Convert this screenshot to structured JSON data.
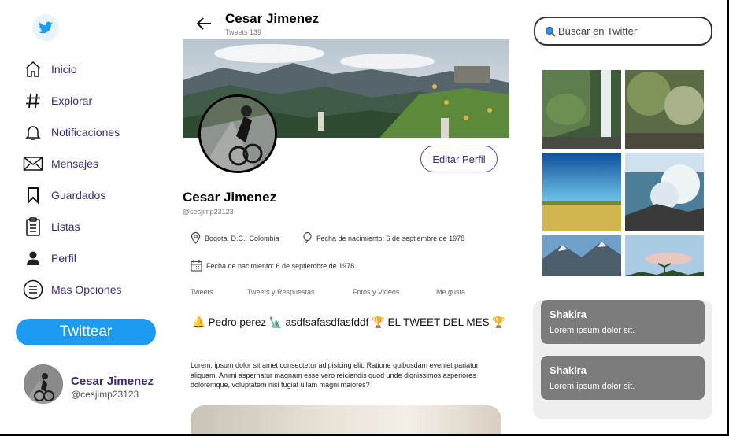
{
  "sidebar": {
    "logo": "twitter-bird-icon",
    "items": [
      {
        "label": "Inicio",
        "icon": "home-icon"
      },
      {
        "label": "Explorar",
        "icon": "hashtag-icon"
      },
      {
        "label": "Notificaciones",
        "icon": "bell-icon"
      },
      {
        "label": "Mensajes",
        "icon": "envelope-icon"
      },
      {
        "label": "Guardados",
        "icon": "bookmark-icon"
      },
      {
        "label": "Listas",
        "icon": "clipboard-icon"
      },
      {
        "label": "Perfil",
        "icon": "person-icon"
      },
      {
        "label": "Mas Opciones",
        "icon": "more-options-icon"
      }
    ],
    "tweet_button": "Twittear",
    "account": {
      "name": "Cesar Jimenez",
      "handle": "@cesjimp23123"
    }
  },
  "header": {
    "name": "Cesar Jimenez",
    "tweet_count": "Tweets 139"
  },
  "profile": {
    "edit_button": "Editar Perfil",
    "name": "Cesar Jimenez",
    "handle": "@cesjimp23123",
    "location": "Bogota, D.C., Colombia",
    "birth": "Fecha de nacimiento: 6 de septiembre de 1978",
    "joined": "Fecha de nacimiento: 6 de septiembre de 1978"
  },
  "tabs": [
    "Tweets",
    "Tweets y Respuestas",
    "Fotos y Videos",
    "Me gusta"
  ],
  "tweet": {
    "headline": "🔔 Pedro perez 🗽 asdfsafasdfasfddf 🏆 EL TWEET DEL MES 🏆",
    "body": "Lorem, ipsum dolor sit amet consectetur adipisicing elit. Ratione quibusdam eveniet pariatur aliquam. Animi aspernatur magnam esse vero reiciendis quod unde dignissimos asperiores doloremque, voluptatem nisi fugiat ullam magni maiores?"
  },
  "search": {
    "placeholder": "Buscar en Twitter"
  },
  "trends": [
    {
      "title": "Shakira",
      "text": "Lorem ipsum dolor sit."
    },
    {
      "title": "Shakira",
      "text": "Lorem ipsum dolor sit."
    }
  ],
  "colors": {
    "accent": "#1d9bf0",
    "nav_text": "#3d2a73",
    "trend_card": "#7c7c7c"
  }
}
